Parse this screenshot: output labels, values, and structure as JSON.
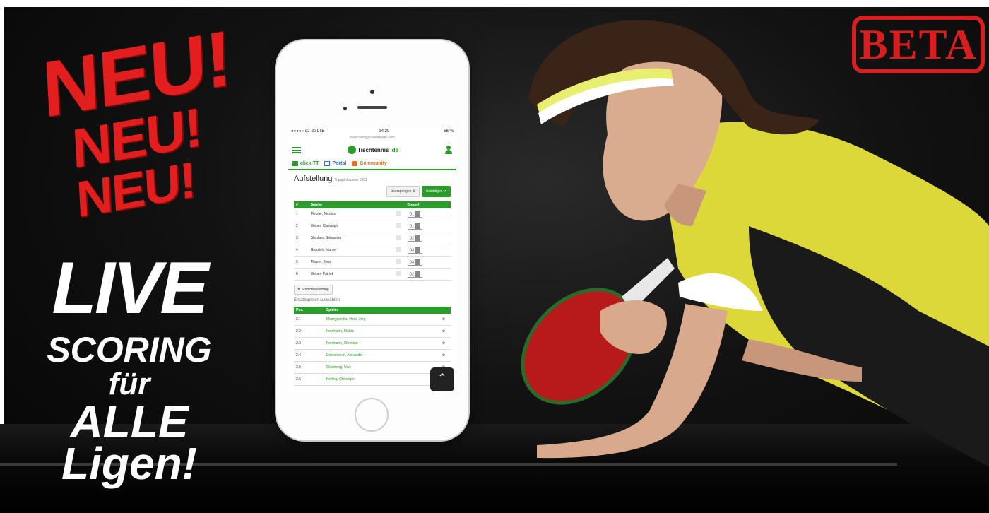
{
  "headline": {
    "neu1": "NEU!",
    "neu2": "NEU!",
    "neu3": "NEU!",
    "live": "LIVE",
    "scoring": "SCORING",
    "fuer": "für",
    "alle": "ALLE",
    "ligen": "Ligen!"
  },
  "stamp": {
    "label": "BETA"
  },
  "phone": {
    "status": {
      "carrier": "●●●●○ o2-de  LTE",
      "time": "14:39",
      "battery": "56 %"
    },
    "url": "livescoring.ps-webforge.com",
    "logo": {
      "name": "Tischtennis",
      "tld": ".de"
    },
    "nav": [
      {
        "label": "click-TT"
      },
      {
        "label": "Portal"
      },
      {
        "label": "Community"
      }
    ],
    "page": {
      "title": "Aufstellung",
      "subtitle": "Topspinhausen 1931",
      "skip_label": "überspringen",
      "confirm_label": "bestätigen"
    },
    "lineup_headers": [
      "#",
      "Spieler",
      "",
      "Doppel"
    ],
    "lineup": [
      {
        "pos": "1",
        "name": "Metzler, Nicolas",
        "doppel": "D1"
      },
      {
        "pos": "2",
        "name": "Weber, Christoph",
        "doppel": "D1"
      },
      {
        "pos": "3",
        "name": "Stephan, Sebastian",
        "doppel": "D2"
      },
      {
        "pos": "4",
        "name": "Greulich, Marcel",
        "doppel": "D3"
      },
      {
        "pos": "5",
        "name": "Maurer, Jens",
        "doppel": "D3"
      },
      {
        "pos": "6",
        "name": "Weber, Patrick",
        "doppel": "D2"
      }
    ],
    "stamm_button": "Stammbesetzung",
    "replacement_label": "Ersatzspieler auswählen",
    "replacement_headers": [
      "Pos.",
      "Spieler",
      ""
    ],
    "replacements": [
      {
        "pos": "2.1",
        "name": "Moczygemba, Hans-Jörg"
      },
      {
        "pos": "2.2",
        "name": "Herrmann, Martin"
      },
      {
        "pos": "2.3",
        "name": "Herrmann, Christian"
      },
      {
        "pos": "2.4",
        "name": "Dobberstein, Alexander"
      },
      {
        "pos": "2.5",
        "name": "Eikenberg, Uwe"
      },
      {
        "pos": "2.6",
        "name": "Helfing, Christoph"
      }
    ],
    "fab_icon": "chevron-up-icon"
  },
  "colors": {
    "accent_green": "#2a9c2a",
    "headline_red": "#e31e1e",
    "shirt_yellow": "#e8e04a"
  }
}
